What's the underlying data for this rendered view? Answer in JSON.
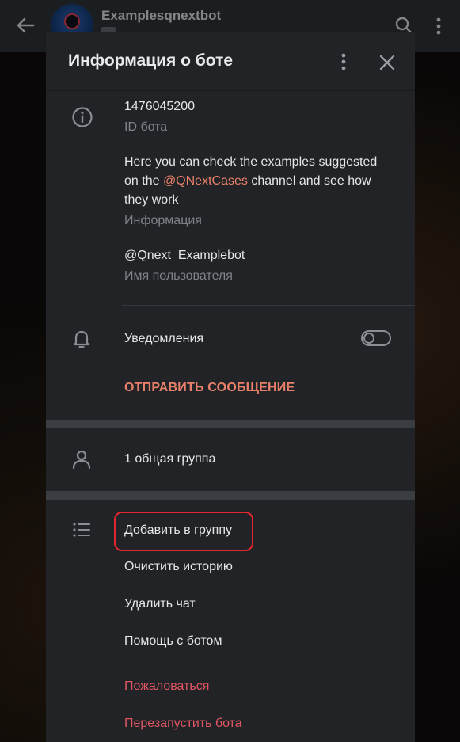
{
  "background": {
    "chat_title": "Examplesqnextbot",
    "icons": [
      "back-arrow-icon",
      "avatar",
      "search-icon",
      "more-vertical-icon"
    ]
  },
  "dialog": {
    "title": "Информация о боте",
    "icons": {
      "more": "more-vertical-icon",
      "close": "close-icon"
    },
    "info": {
      "id_value": "1476045200",
      "id_label": "ID бота",
      "description_before": "Here you can check the examples suggested on the ",
      "description_link": "@QNextCases",
      "description_after": " channel and see how they work",
      "description_label": "Информация",
      "username_value": "@Qnext_Examplebot",
      "username_label": "Имя пользователя"
    },
    "notifications": {
      "label": "Уведомления",
      "enabled": false
    },
    "send_message": "ОТПРАВИТЬ СООБЩЕНИЕ",
    "groups": "1 общая группа",
    "menu": {
      "add_to_group": "Добавить в группу",
      "clear_history": "Очистить историю",
      "delete_chat": "Удалить чат",
      "bot_help": "Помощь с ботом",
      "report": "Пожаловаться",
      "restart_bot": "Перезапустить бота"
    }
  },
  "colors": {
    "accent": "#e8806a",
    "danger": "#e25663",
    "highlight_border": "#e0252d",
    "dialog_bg": "#212326"
  }
}
